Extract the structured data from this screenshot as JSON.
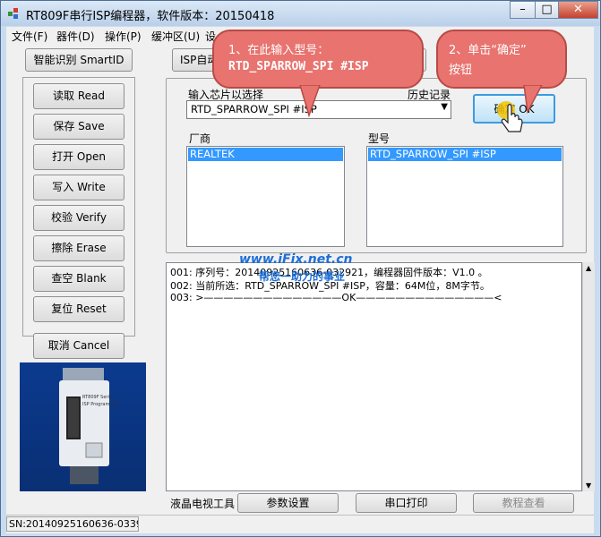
{
  "window": {
    "title": "RT809F串行ISP编程器，软件版本：20150418",
    "min_label": "–",
    "max_label": "□",
    "close_label": "✕"
  },
  "menu": [
    "文件(F)",
    "器件(D)",
    "操作(P)",
    "缓冲区(U)",
    "设"
  ],
  "left_buttons": {
    "smart_identify": "智能识别 SmartID",
    "read": "读取 Read",
    "save": "保存 Save",
    "open": "打开 Open",
    "write": "写入 Write",
    "verify": "校验 Verify",
    "erase": "擦除 Erase",
    "blank": "查空 Blank",
    "reset": "复位 Reset",
    "cancel": "取消 Cancel"
  },
  "top_bar": {
    "isp_button": "ISP自动"
  },
  "chip_input": {
    "label": "输入芯片以选择",
    "history_label": "历史记录",
    "value": "RTD_SPARROW_SPI #ISP",
    "ok_button": "确定 OK"
  },
  "vendor": {
    "label": "厂商",
    "selected": "REALTEK"
  },
  "model": {
    "label": "型号",
    "selected": "RTD_SPARROW_SPI #ISP"
  },
  "log": [
    "001: 序列号：20140925160636-032921，编程器固件版本：V1.0 。",
    "002: 当前所选：RTD_SPARROW_SPI #ISP，容量：64M位，8M字节。",
    "003: >——————————————OK——————————————<"
  ],
  "watermark": {
    "site": "www.iFix.net.cn",
    "slogan": "帮您一助力的事业"
  },
  "bottom_bar": {
    "tool_label": "液晶电视工具",
    "params_button": "参数设置",
    "serial_print_button": "串口打印",
    "tutorial_button": "教程查看"
  },
  "status": {
    "sn": "SN:20140925160636-0339"
  },
  "callouts": {
    "step1_line1": "1、在此输入型号：",
    "step1_line2": "RTD_SPARROW_SPI #ISP",
    "step2_line1": "2、单击“确定”",
    "step2_line2": "按钮"
  },
  "device_photo": {
    "label1": "RT809F Serial",
    "label2": "ISP Programmer"
  },
  "colors": {
    "selection": "#3399ff",
    "callout": "#e8736f",
    "watermark": "#1e6fd6"
  }
}
